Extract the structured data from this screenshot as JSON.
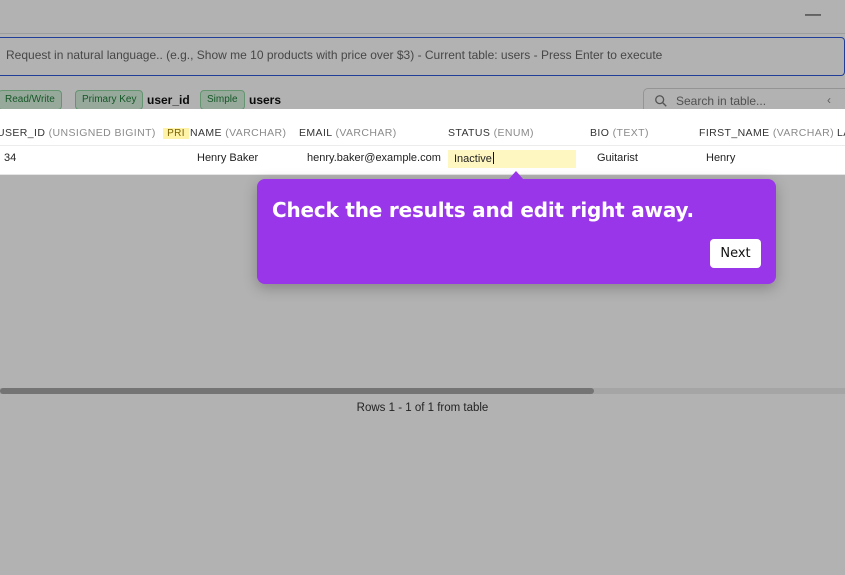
{
  "titlebar": {
    "minimize_glyph": "—"
  },
  "query": {
    "placeholder": "Request in natural language.. (e.g., Show me 10 products with price over $3) - Current table: users - Press Enter to execute"
  },
  "meta": {
    "access_badge": "Read/Write",
    "key_badge": "Primary Key",
    "key_column": "user_id",
    "table_kind_badge": "Simple",
    "table_name": "users"
  },
  "search": {
    "placeholder": "Search in table...",
    "chevron": "‹"
  },
  "table": {
    "columns": [
      {
        "name": "USER_ID",
        "type": "(UNSIGNED BIGINT)",
        "key": "PRI"
      },
      {
        "name": "NAME",
        "type": "(VARCHAR)"
      },
      {
        "name": "EMAIL",
        "type": "(VARCHAR)"
      },
      {
        "name": "STATUS",
        "type": "(ENUM)"
      },
      {
        "name": "BIO",
        "type": "(TEXT)"
      },
      {
        "name": "FIRST_NAME",
        "type": "(VARCHAR)"
      },
      {
        "name": "LA",
        "type": ""
      }
    ],
    "rows": [
      {
        "user_id": "34",
        "name": "Henry Baker",
        "email": "henry.baker@example.com",
        "status": "Inactive",
        "bio": "Guitarist",
        "first_name": "Henry"
      }
    ]
  },
  "footer": {
    "rows_text": "Rows 1 - 1 of 1 from table"
  },
  "tour": {
    "message": "Check the results and edit right away.",
    "next_label": "Next",
    "accent": "#9a36ea"
  }
}
